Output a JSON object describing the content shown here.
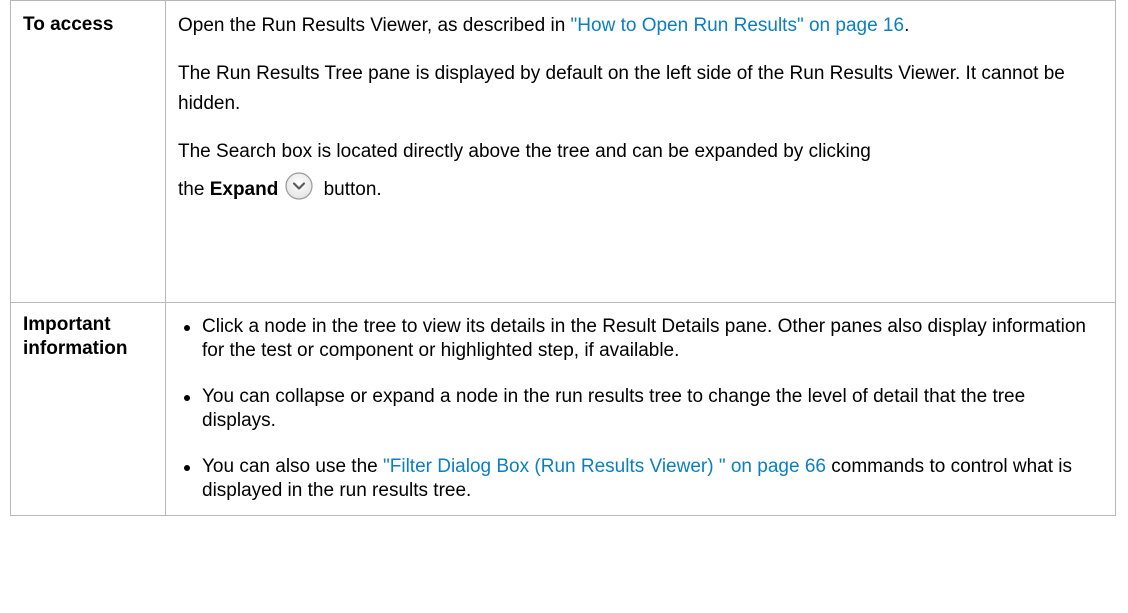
{
  "access": {
    "label": "To access",
    "p1_text": "Open the Run Results Viewer, as described in ",
    "p1_link": "\"How to Open Run Results\" on page 16",
    "p1_end": ".",
    "p2": "The Run Results Tree pane is displayed by default on the left side of the Run Results Viewer. It cannot be hidden.",
    "p3": "The Search box is located directly above the tree and can be expanded by clicking",
    "p4_pre": "the ",
    "p4_bold": "Expand",
    "p4_post": " button.",
    "icon": "chevron-down-circle-icon"
  },
  "important": {
    "label_line1": "Important",
    "label_line2": "information",
    "bullets": [
      {
        "text": "Click a node in the tree to view its details in the Result Details pane. Other panes also display information for the test or component or highlighted step, if available."
      },
      {
        "text": "You can collapse or expand a node in the run results tree to change the level of detail that the tree displays."
      },
      {
        "pre": "You can also use the ",
        "link": "\"Filter Dialog Box (Run Results Viewer) \" on page 66",
        "post": " commands to control what is displayed in the run results tree."
      }
    ]
  },
  "colors": {
    "link": "#0a7fc2",
    "border": "#b8b8b8",
    "text": "#000000"
  }
}
